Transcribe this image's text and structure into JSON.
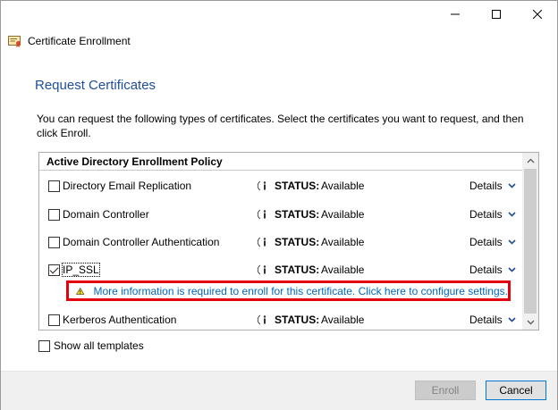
{
  "window": {
    "title": "Certificate Enrollment",
    "icons": {
      "app": "certificate-enrollment-icon",
      "minimize": "minimize-icon",
      "maximize": "maximize-icon",
      "close": "close-icon"
    }
  },
  "page": {
    "heading": "Request Certificates",
    "intro": "You can request the following types of certificates. Select the certificates you want to request, and then click Enroll."
  },
  "policy": {
    "header": "Active Directory Enrollment Policy",
    "status_label": "STATUS:",
    "details_label": "Details",
    "items": [
      {
        "name": "Directory Email Replication",
        "status": "Available",
        "checked": false
      },
      {
        "name": "Domain Controller",
        "status": "Available",
        "checked": false
      },
      {
        "name": "Domain Controller Authentication",
        "status": "Available",
        "checked": false
      },
      {
        "name": "IP_SSL",
        "status": "Available",
        "checked": true
      },
      {
        "name": "Kerberos Authentication",
        "status": "Available",
        "checked": false
      }
    ],
    "warning": "More information is required to enroll for this certificate. Click here to configure settings."
  },
  "options": {
    "show_all": "Show all templates"
  },
  "buttons": {
    "enroll": "Enroll",
    "cancel": "Cancel"
  },
  "colors": {
    "heading": "#1f4e9c",
    "link": "#0067c0",
    "warning_border": "#e3000f",
    "cancel_border": "#0078d7"
  }
}
